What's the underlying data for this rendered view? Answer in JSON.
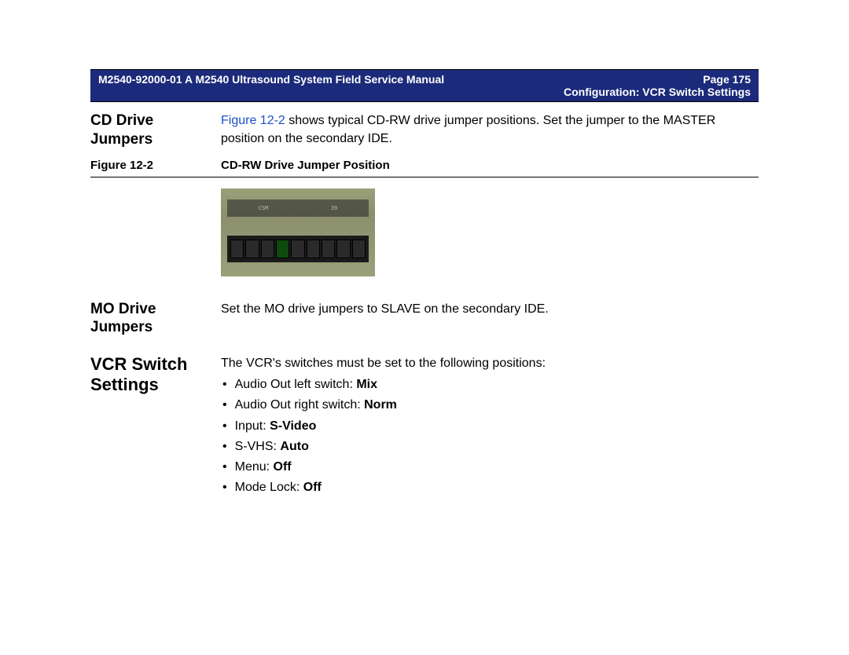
{
  "header": {
    "doc_id": "M2540-92000-01 A M2540 Ultrasound System Field Service Manual",
    "page_label": "Page 175",
    "section_path": "Configuration: VCR Switch Settings"
  },
  "cd_drive": {
    "heading": "CD Drive Jumpers",
    "figure_ref": "Figure 12-2",
    "text_before_ref": "",
    "text_after_ref": " shows typical CD-RW drive jumper positions. Set the jumper to the MASTER position on the secondary IDE."
  },
  "figure": {
    "label": "Figure 12-2",
    "title": "CD-RW Drive Jumper Position"
  },
  "mo_drive": {
    "heading": "MO Drive Jumpers",
    "text": "Set the MO drive jumpers to SLAVE on the secondary IDE."
  },
  "vcr": {
    "heading": "VCR Switch Settings",
    "intro": "The VCR's switches must be set to the following positions:",
    "items": [
      {
        "label": "Audio Out left switch: ",
        "value": "Mix"
      },
      {
        "label": "Audio Out right switch: ",
        "value": "Norm"
      },
      {
        "label": "Input: ",
        "value": "S-Video"
      },
      {
        "label": "S-VHS: ",
        "value": "Auto"
      },
      {
        "label": "Menu: ",
        "value": "Off"
      },
      {
        "label": "Mode Lock: ",
        "value": "Off"
      }
    ]
  }
}
